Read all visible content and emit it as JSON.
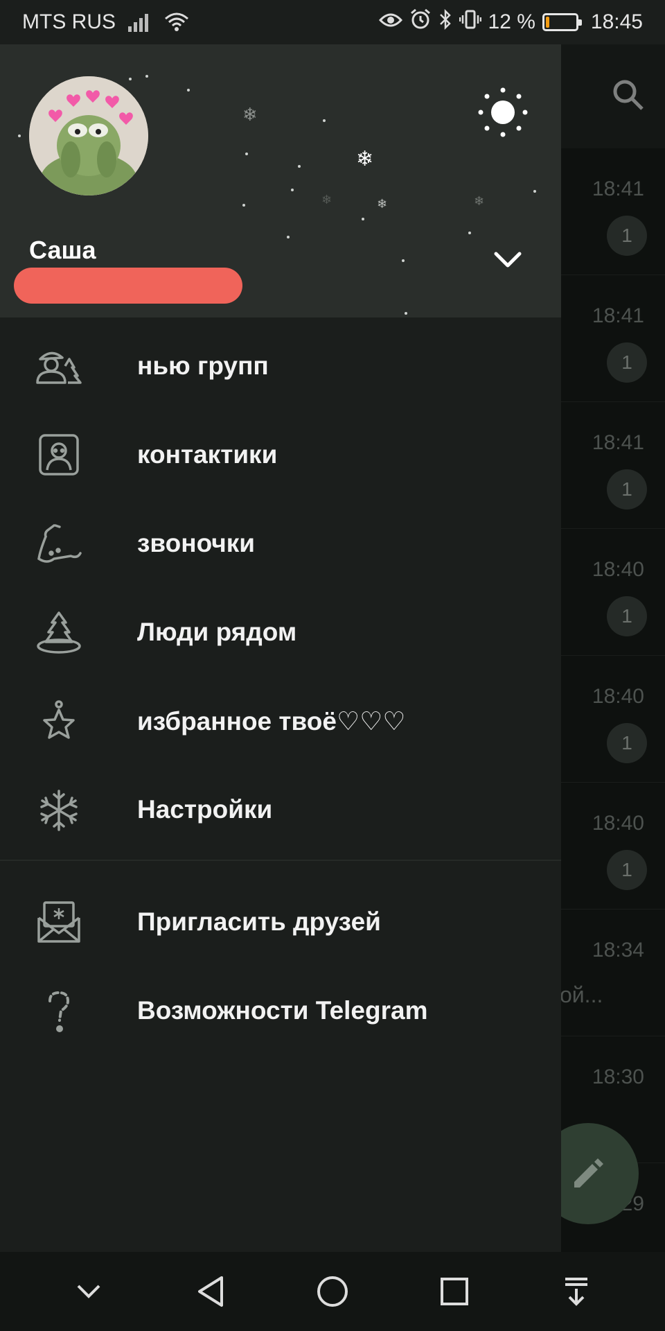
{
  "status_bar": {
    "carrier": "MTS RUS",
    "battery_text": "12 %",
    "time": "18:45",
    "battery_level": 0.12,
    "battery_color": "#f39c12"
  },
  "drawer": {
    "username": "Саша",
    "menu": [
      {
        "label": "нью групп",
        "icon": "new-group-icon"
      },
      {
        "label": "контактики",
        "icon": "contacts-icon"
      },
      {
        "label": "звоночки",
        "icon": "calls-icon"
      },
      {
        "label": "Люди рядом",
        "icon": "people-nearby-icon"
      },
      {
        "label": "избранное твоё♡♡♡",
        "icon": "saved-star-icon"
      },
      {
        "label": "Настройки",
        "icon": "settings-snowflake-icon"
      }
    ],
    "secondary_menu": [
      {
        "label": "Пригласить друзей",
        "icon": "invite-friends-icon"
      },
      {
        "label": "Возможности Telegram",
        "icon": "telegram-features-icon"
      }
    ]
  },
  "chat_list": {
    "rows": [
      {
        "time": "18:41",
        "badge": "1"
      },
      {
        "time": "18:41",
        "badge": "1"
      },
      {
        "time": "18:41",
        "badge": "1"
      },
      {
        "time": "18:40",
        "badge": "1"
      },
      {
        "time": "18:40",
        "badge": "1"
      },
      {
        "time": "18:40",
        "badge": "1"
      },
      {
        "time": "18:34",
        "snippet": "ой..."
      },
      {
        "time": "18:30"
      },
      {
        "time": "29"
      }
    ]
  },
  "colors": {
    "accent_redaction": "#f0645a",
    "drawer_bg": "#1b1e1c",
    "header_bg": "#2a2e2b"
  }
}
